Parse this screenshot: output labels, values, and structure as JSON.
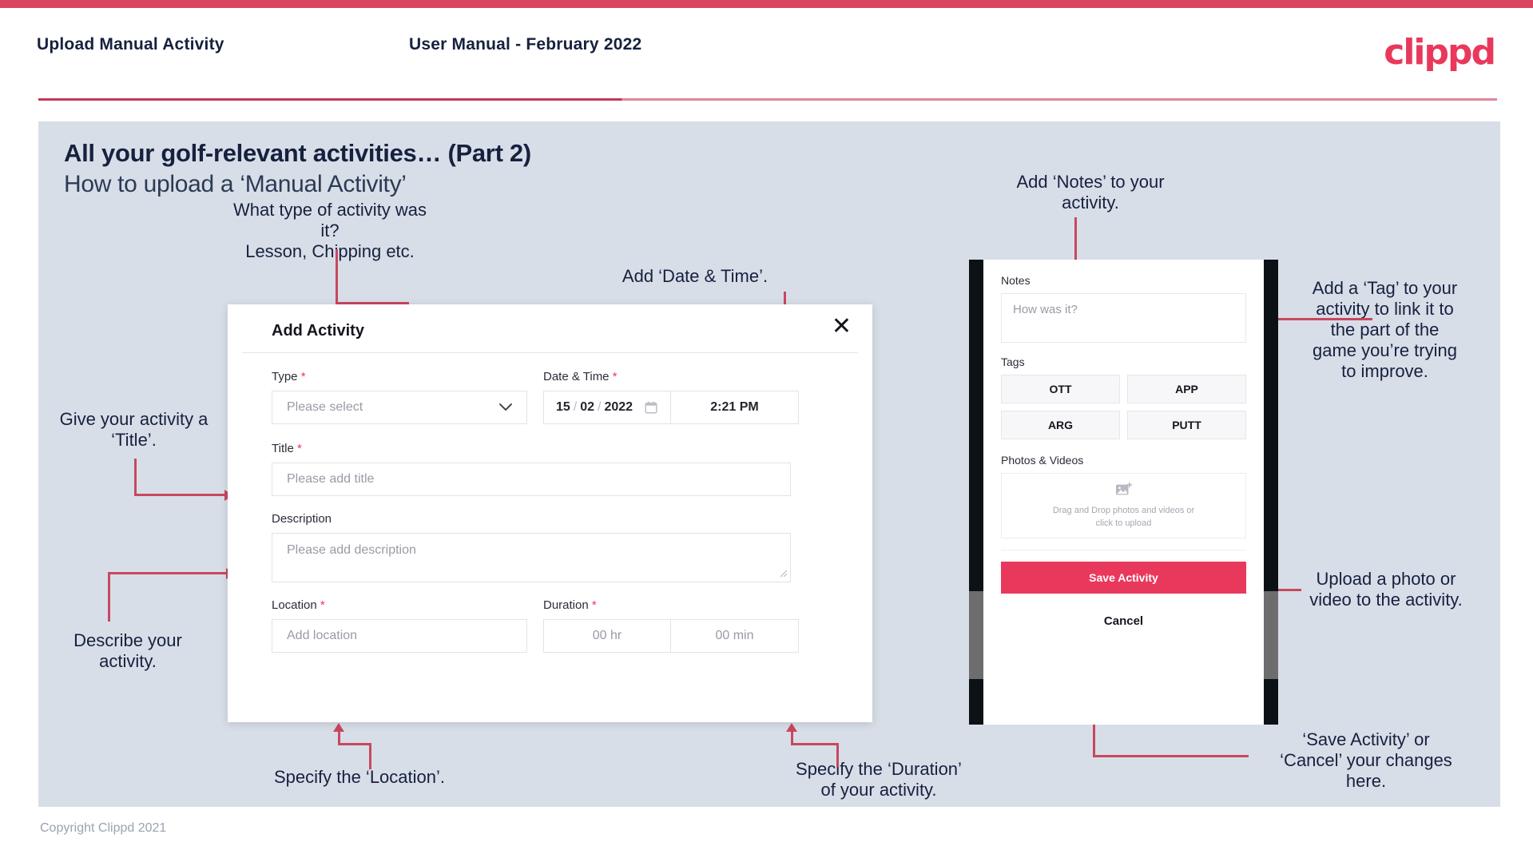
{
  "header": {
    "title": "Upload Manual Activity",
    "subtitle": "User Manual - February 2022",
    "logo": "clippd"
  },
  "slide": {
    "title": "All your golf-relevant activities… (Part 2)",
    "subtitle": "How to upload a ‘Manual Activity’",
    "copyright": "Copyright Clippd 2021"
  },
  "annotations": {
    "type": "What type of activity was it?\nLesson, Chipping etc.",
    "datetime": "Add ‘Date & Time’.",
    "title": "Give your activity a\n‘Title’.",
    "description": "Describe your\nactivity.",
    "location": "Specify the ‘Location’.",
    "duration": "Specify the ‘Duration’\nof your activity.",
    "notes": "Add ‘Notes’ to your\nactivity.",
    "tags": "Add a ‘Tag’ to your\nactivity to link it to\nthe part of the\ngame you’re trying\nto improve.",
    "photos": "Upload a photo or\nvideo to the activity.",
    "save": "‘Save Activity’ or\n‘Cancel’ your changes\nhere."
  },
  "dialog": {
    "title": "Add Activity",
    "close_icon": "close-icon",
    "fields": {
      "type": {
        "label": "Type",
        "required": "*",
        "placeholder": "Please select",
        "chevron": "⌄"
      },
      "datetime": {
        "label": "Date & Time",
        "required": "*",
        "day": "15",
        "sep1": "/",
        "month": "02",
        "sep2": "/",
        "year": "2022",
        "time": "2:21 PM"
      },
      "title": {
        "label": "Title",
        "required": "*",
        "placeholder": "Please add title"
      },
      "description": {
        "label": "Description",
        "placeholder": "Please add description"
      },
      "location": {
        "label": "Location",
        "required": "*",
        "placeholder": "Add location"
      },
      "duration": {
        "label": "Duration",
        "required": "*",
        "hours": "00 hr",
        "minutes": "00 min"
      }
    }
  },
  "phone": {
    "notes": {
      "label": "Notes",
      "placeholder": "How was it?"
    },
    "tags": {
      "label": "Tags",
      "items": [
        "OTT",
        "APP",
        "ARG",
        "PUTT"
      ]
    },
    "photos": {
      "label": "Photos & Videos",
      "dropzone_line1": "Drag and Drop photos and videos or",
      "dropzone_line2": "click to upload"
    },
    "save_label": "Save Activity",
    "cancel_label": "Cancel"
  },
  "colors": {
    "accent": "#e8395c",
    "accent_dark": "#c8485f",
    "slide_bg": "#d8dee8",
    "text": "#16213e"
  }
}
